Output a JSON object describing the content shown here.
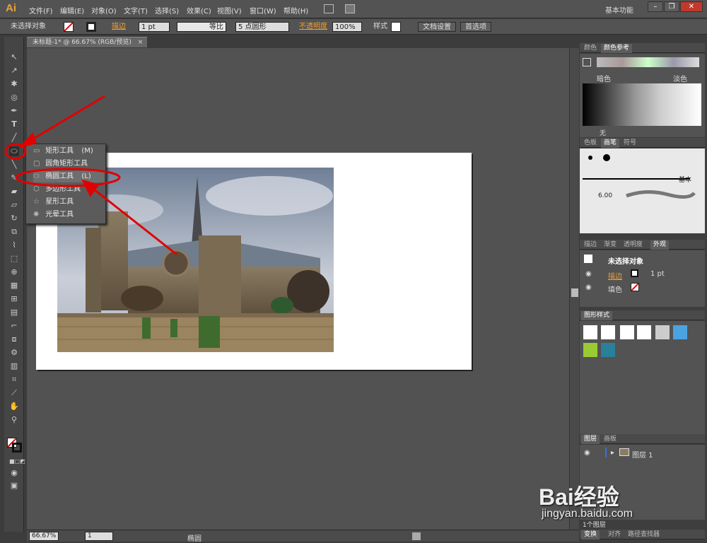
{
  "app": {
    "logo": "Ai"
  },
  "menu": [
    "文件(F)",
    "编辑(E)",
    "对象(O)",
    "文字(T)",
    "选择(S)",
    "效果(C)",
    "视图(V)",
    "窗口(W)",
    "帮助(H)"
  ],
  "workspace": {
    "name": "基本功能"
  },
  "control_bar": {
    "selection": "未选择对象",
    "stroke_label": "描边",
    "stroke_weight": "1 pt",
    "profile": "等比",
    "brush": "5 点圆形",
    "opacity_label": "不透明度",
    "opacity_value": "100%",
    "style_label": "样式",
    "doc_setup": "文档设置",
    "preferences": "首选项"
  },
  "document": {
    "tab_title": "未标题-1* @ 66.67% (RGB/预览)"
  },
  "flyout": {
    "items": [
      {
        "label": "矩形工具",
        "shortcut": "(M)"
      },
      {
        "label": "圆角矩形工具",
        "shortcut": ""
      },
      {
        "label": "椭圆工具",
        "shortcut": "(L)"
      },
      {
        "label": "多边形工具",
        "shortcut": ""
      },
      {
        "label": "星形工具",
        "shortcut": ""
      },
      {
        "label": "光晕工具",
        "shortcut": ""
      }
    ]
  },
  "status": {
    "zoom": "66.67%",
    "page": "1",
    "tool": "椭圆"
  },
  "panels": {
    "color": {
      "tabs": [
        "颜色",
        "颜色参考"
      ],
      "dark": "暗色",
      "light": "淡色",
      "none": "无"
    },
    "brushes": {
      "tabs": [
        "色板",
        "画笔",
        "符号"
      ],
      "basic": "基本",
      "size": "6.00"
    },
    "appearance": {
      "tabs": [
        "描边",
        "渐变",
        "透明度",
        "外观"
      ],
      "title": "未选择对象",
      "stroke": "描边",
      "stroke_value": "1 pt",
      "fill": "填色"
    },
    "graphic_styles": {
      "title": "图形样式"
    },
    "layers": {
      "tabs": [
        "图层",
        "画板"
      ],
      "layer_name": "图层 1",
      "count": "1个图层"
    },
    "bottom_tabs": [
      "变换",
      "对齐",
      "路径查找器"
    ]
  },
  "watermark": {
    "brand": "Bai经验",
    "url": "jingyan.baidu.com"
  },
  "colors": {
    "accent": "#f0a030",
    "annotation": "#e00000",
    "ui_bg": "#535353"
  }
}
